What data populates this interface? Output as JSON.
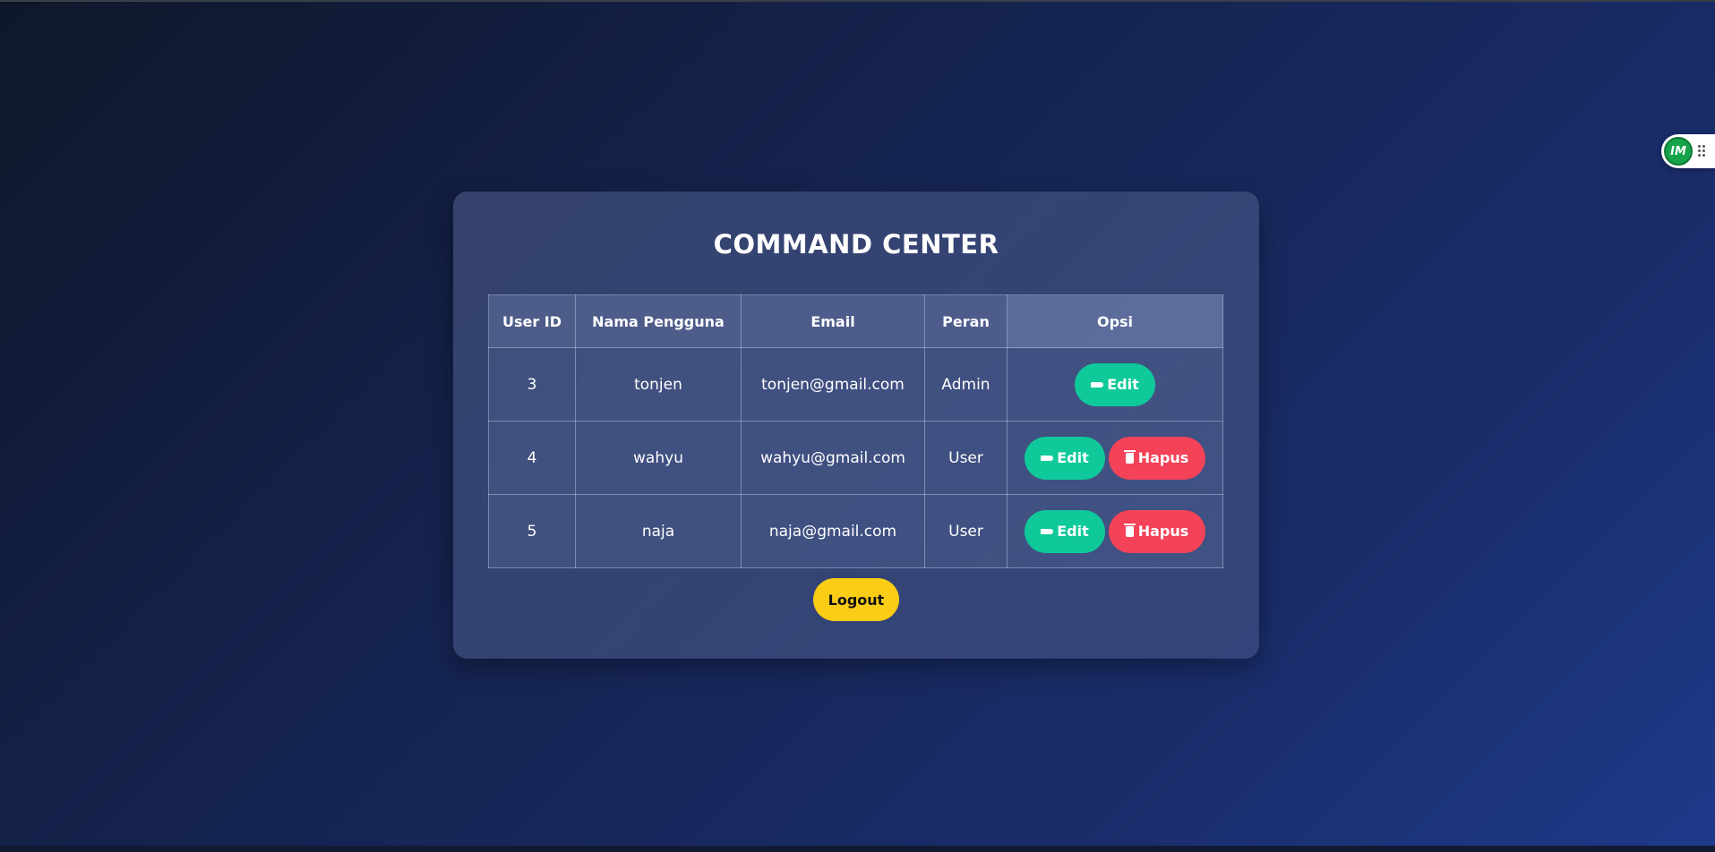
{
  "panel": {
    "title": "COMMAND CENTER"
  },
  "table": {
    "headers": [
      "User ID",
      "Nama Pengguna",
      "Email",
      "Peran",
      "Opsi"
    ],
    "rows": [
      {
        "id": "3",
        "name": "tonjen",
        "email": "tonjen@gmail.com",
        "role": "Admin",
        "actions": [
          "Edit"
        ]
      },
      {
        "id": "4",
        "name": "wahyu",
        "email": "wahyu@gmail.com",
        "role": "User",
        "actions": [
          "Edit",
          "Hapus"
        ]
      },
      {
        "id": "5",
        "name": "naja",
        "email": "naja@gmail.com",
        "role": "User",
        "actions": [
          "Edit",
          "Hapus"
        ]
      }
    ]
  },
  "actions": {
    "edit_label": "Edit",
    "delete_label": "Hapus",
    "edit_icon": "pencil-icon",
    "delete_icon": "trash-icon"
  },
  "logout_label": "Logout",
  "widget": {
    "logo_text": "IM",
    "handle_icon": "drag-handle-icon"
  },
  "colors": {
    "edit_button": "#10c99a",
    "delete_button": "#f44258",
    "logout_button": "#facc15",
    "widget_logo": "#16a34a"
  }
}
